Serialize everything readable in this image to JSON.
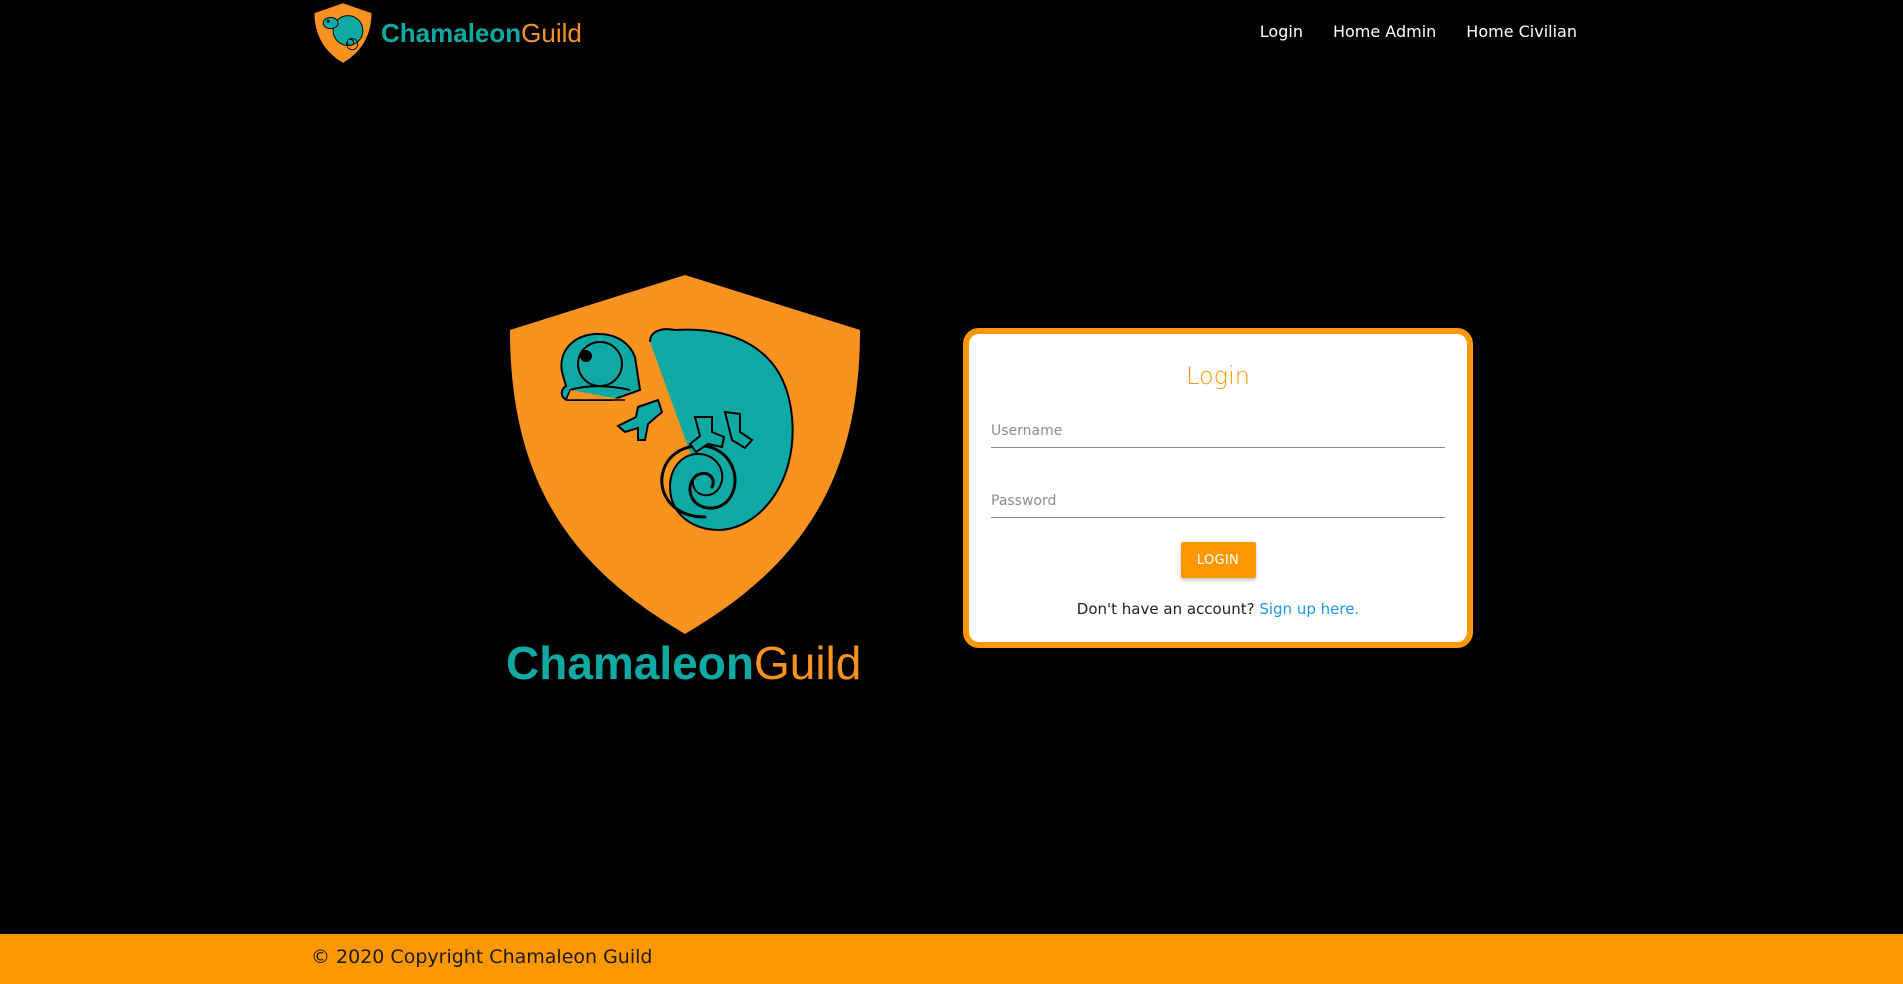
{
  "navbar": {
    "brand": {
      "word1": "Chamaleon",
      "word2": "Guild"
    },
    "links": [
      {
        "label": "Login"
      },
      {
        "label": "Home Admin"
      },
      {
        "label": "Home Civilian"
      }
    ]
  },
  "hero": {
    "word1": "Chamaleon",
    "word2": "Guild"
  },
  "login": {
    "title": "Login",
    "username": {
      "value": "",
      "placeholder": "Username"
    },
    "password": {
      "value": "",
      "placeholder": "Password"
    },
    "button_label": "LOGIN",
    "signup_prompt": "Don't have an account? ",
    "signup_link": "Sign up here."
  },
  "footer": {
    "copyright": "© 2020 Copyright Chamaleon Guild"
  },
  "colors": {
    "background": "#000000",
    "accent_orange": "#ff9800",
    "shield_orange": "#f7931e",
    "teal": "#0ea9a3",
    "link_blue": "#2196f3"
  }
}
